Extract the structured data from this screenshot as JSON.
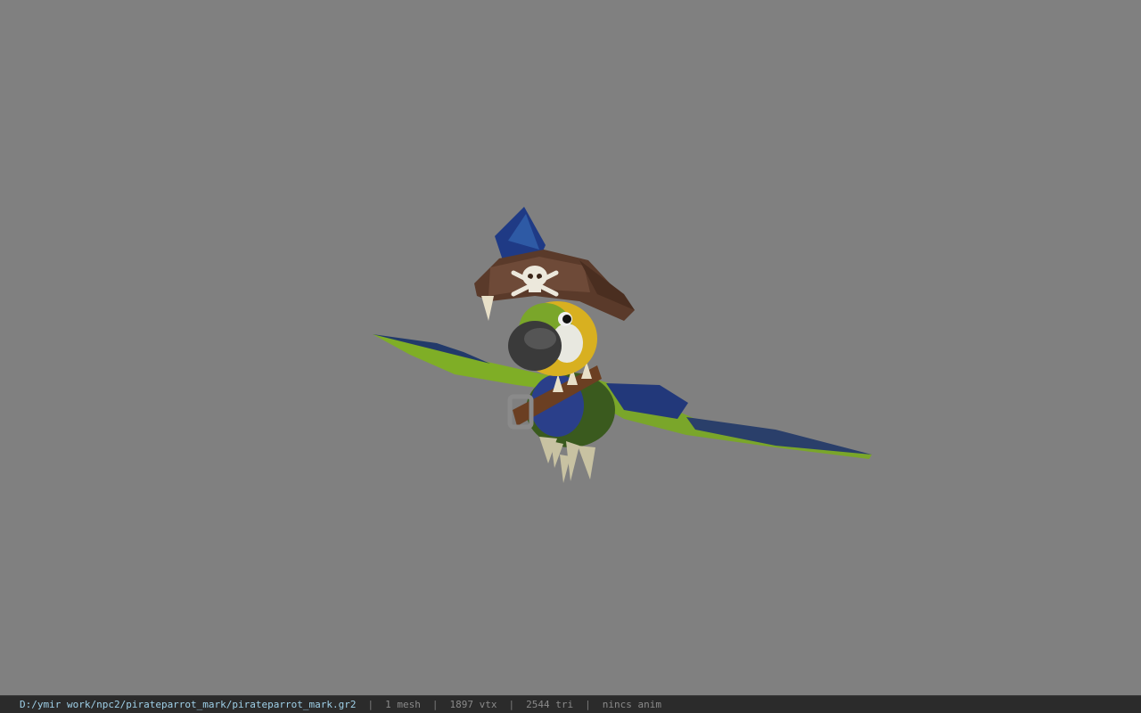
{
  "viewport": {
    "background_color": "#808080",
    "model_name": "pirate parrot"
  },
  "status_bar": {
    "file_path": "D:/ymir work/npc2/pirateparrot_mark/pirateparrot_mark.gr2",
    "separator": "|",
    "mesh_count": "1 mesh",
    "vertex_count": "1897 vtx",
    "triangle_count": "2544 tri",
    "anim_status": "nincs anim",
    "path_color": "#9fd0e8",
    "background_color": "#2b2b2b"
  }
}
